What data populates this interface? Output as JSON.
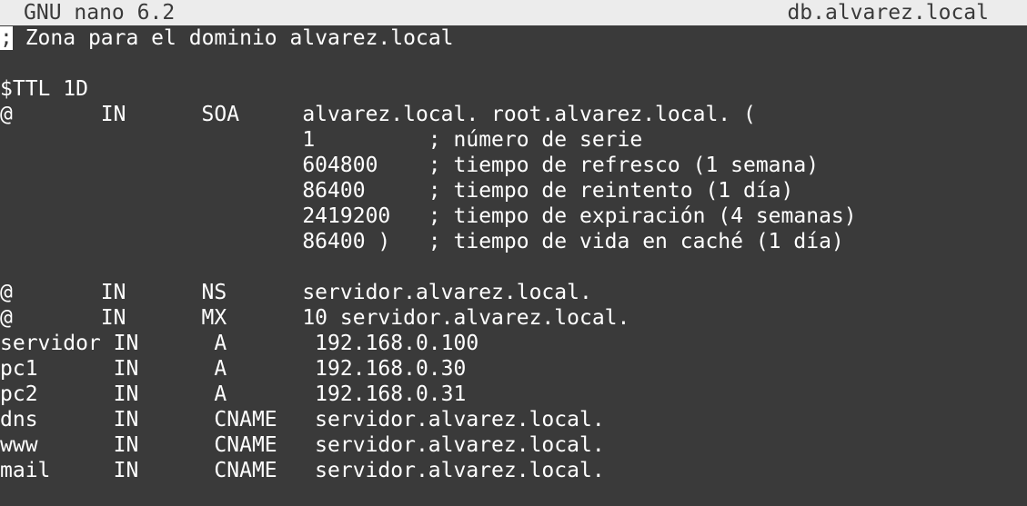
{
  "titlebar": {
    "version": "GNU nano 6.2",
    "filename": "db.alvarez.local"
  },
  "editor": {
    "cursor_char": ";",
    "lines": [
      " Zona para el dominio alvarez.local",
      "",
      "$TTL 1D",
      "@       IN      SOA     alvarez.local. root.alvarez.local. (",
      "                        1         ; número de serie",
      "                        604800    ; tiempo de refresco (1 semana)",
      "                        86400     ; tiempo de reintento (1 día)",
      "                        2419200   ; tiempo de expiración (4 semanas)",
      "                        86400 )   ; tiempo de vida en caché (1 día)",
      "",
      "@       IN      NS      servidor.alvarez.local.",
      "@       IN      MX      10 servidor.alvarez.local.",
      "servidor IN      A       192.168.0.100",
      "pc1      IN      A       192.168.0.30",
      "pc2      IN      A       192.168.0.31",
      "dns      IN      CNAME   servidor.alvarez.local.",
      "www      IN      CNAME   servidor.alvarez.local.",
      "mail     IN      CNAME   servidor.alvarez.local."
    ]
  },
  "colors": {
    "background": "#3a3a3a",
    "titlebar_bg": "#ececec",
    "titlebar_fg": "#3a3a3a",
    "text": "#ffffff"
  }
}
